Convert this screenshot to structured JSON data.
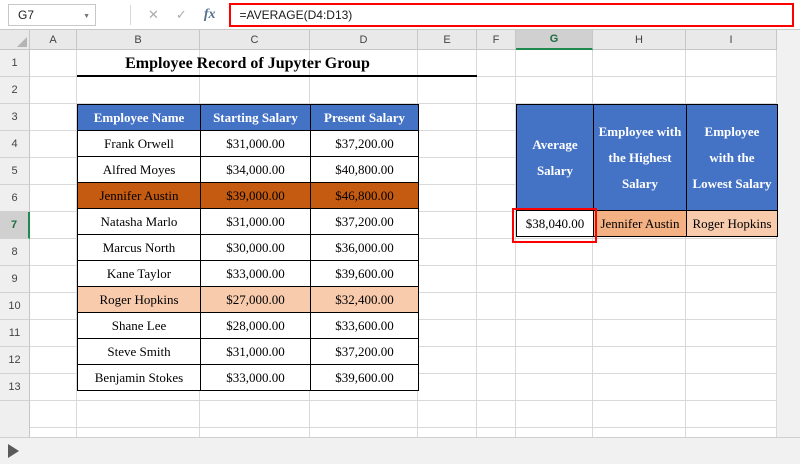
{
  "formula_bar": {
    "name_box_value": "G7",
    "formula": "=AVERAGE(D4:D13)",
    "cancel_label": "✕",
    "enter_label": "✓",
    "fx_label": "fx"
  },
  "columns": [
    "A",
    "B",
    "C",
    "D",
    "E",
    "F",
    "G",
    "H",
    "I"
  ],
  "rows": [
    "1",
    "2",
    "3",
    "4",
    "5",
    "6",
    "7",
    "8",
    "9",
    "10",
    "11",
    "12",
    "13"
  ],
  "title": "Employee Record of Jupyter Group",
  "main_table": {
    "headers": [
      "Employee Name",
      "Starting Salary",
      "Present Salary"
    ],
    "rows": [
      {
        "name": "Frank Orwell",
        "starting": "$31,000.00",
        "present": "$37,200.00",
        "highlight": "none"
      },
      {
        "name": "Alfred Moyes",
        "starting": "$34,000.00",
        "present": "$40,800.00",
        "highlight": "none"
      },
      {
        "name": "Jennifer Austin",
        "starting": "$39,000.00",
        "present": "$46,800.00",
        "highlight": "dark-orange"
      },
      {
        "name": "Natasha Marlo",
        "starting": "$31,000.00",
        "present": "$37,200.00",
        "highlight": "none"
      },
      {
        "name": "Marcus North",
        "starting": "$30,000.00",
        "present": "$36,000.00",
        "highlight": "none"
      },
      {
        "name": "Kane Taylor",
        "starting": "$33,000.00",
        "present": "$39,600.00",
        "highlight": "none"
      },
      {
        "name": "Roger Hopkins",
        "starting": "$27,000.00",
        "present": "$32,400.00",
        "highlight": "light-orange"
      },
      {
        "name": "Shane Lee",
        "starting": "$28,000.00",
        "present": "$33,600.00",
        "highlight": "none"
      },
      {
        "name": "Steve Smith",
        "starting": "$31,000.00",
        "present": "$37,200.00",
        "highlight": "none"
      },
      {
        "name": "Benjamin Stokes",
        "starting": "$33,000.00",
        "present": "$39,600.00",
        "highlight": "none"
      }
    ]
  },
  "summary_table": {
    "headers": [
      "Average Salary",
      "Employee with the Highest Salary",
      "Employee with the Lowest Salary"
    ],
    "values": [
      "$38,040.00",
      "Jennifer Austin",
      "Roger Hopkins"
    ]
  },
  "selection": {
    "cell": "G7",
    "column": "G",
    "row": "7"
  },
  "colors": {
    "header_blue": "#4472C4",
    "highlight_dark_orange": "#C55A11",
    "highlight_light_orange": "#F8CBAD",
    "highlight_medium_orange": "#F4B183",
    "annotation_red": "#FE0000",
    "selected_header_green": "#1E8A4F"
  }
}
